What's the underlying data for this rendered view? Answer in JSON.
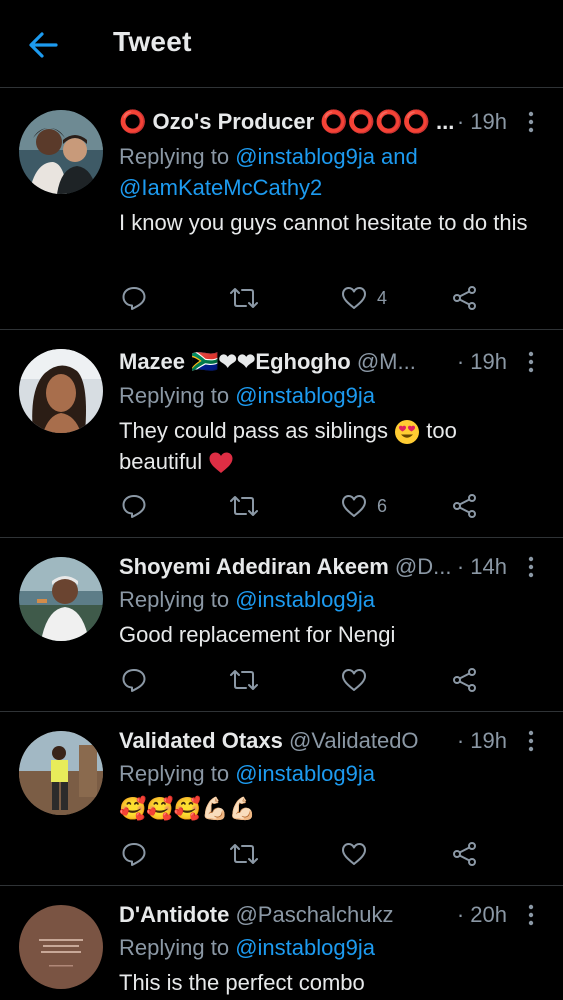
{
  "header": {
    "title": "Tweet"
  },
  "tweets": [
    {
      "name": "⭕ Ozo's Producer ⭕⭕⭕⭕ ...",
      "handle": "",
      "time": "· 19h",
      "reply_prefix": "Replying to ",
      "reply_mentions": "@instablog9ja and",
      "reply_mentions2": "@IamKateMcCathy2",
      "text": "I know you guys cannot hesitate to do this",
      "likes": "4"
    },
    {
      "name": "Mazee 🇿🇦❤❤Eghogho",
      "handle": "@M...",
      "time": "· 19h",
      "reply_prefix": "Replying to ",
      "reply_mentions": "@instablog9ja",
      "text_a": "They could pass as siblings",
      "text_b": "too",
      "text_c": "beautiful",
      "likes": "6"
    },
    {
      "name": "Shoyemi Adediran Akeem",
      "handle": "@D...",
      "time": "· 14h",
      "reply_prefix": "Replying to ",
      "reply_mentions": "@instablog9ja",
      "text": "Good replacement for Nengi",
      "likes": ""
    },
    {
      "name": "Validated Otaxs",
      "handle": "@ValidatedO",
      "time": "· 19h",
      "reply_prefix": "Replying to ",
      "reply_mentions": "@instablog9ja",
      "text": "🥰🥰🥰💪🏻💪🏻",
      "likes": ""
    },
    {
      "name": "D'Antidote",
      "handle": "@Paschalchukz",
      "time": "· 20h",
      "reply_prefix": "Replying to ",
      "reply_mentions": "@instablog9ja",
      "text": "This is the perfect combo",
      "likes": ""
    }
  ],
  "colors": {
    "accent": "#1d9bf0",
    "muted": "#8b98a5",
    "background": "#000000",
    "heart": "#e0245e"
  }
}
